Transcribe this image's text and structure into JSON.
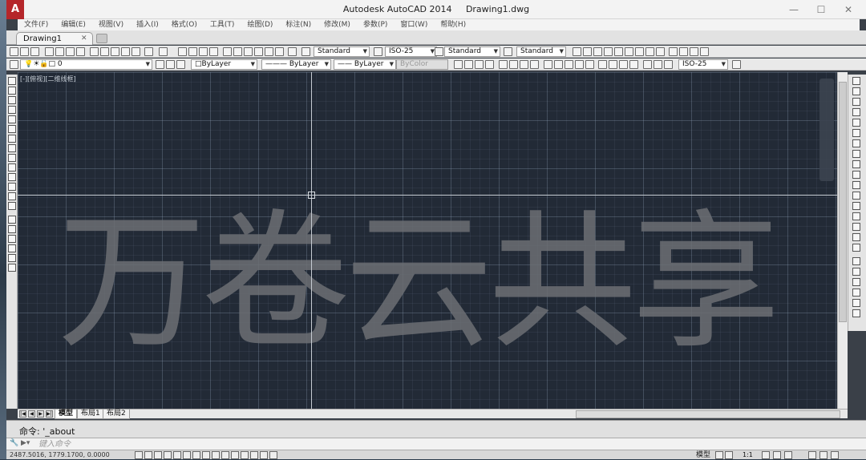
{
  "title": {
    "app": "Autodesk AutoCAD 2014",
    "file": "Drawing1.dwg",
    "logo": "A"
  },
  "window_buttons": {
    "minimize": "—",
    "maximize": "☐",
    "close": "✕"
  },
  "menu": [
    "文件(F)",
    "编辑(E)",
    "视图(V)",
    "插入(I)",
    "格式(O)",
    "工具(T)",
    "绘图(D)",
    "标注(N)",
    "修改(M)",
    "参数(P)",
    "窗口(W)",
    "帮助(H)"
  ],
  "doc_tab": {
    "label": "Drawing1",
    "close": "✕"
  },
  "toolbar1": {
    "text_style": "Standard",
    "dim_style": "ISO-25",
    "table_style": "Standard",
    "mleader_style": "Standard"
  },
  "toolbar2": {
    "layer": "0",
    "color": "ByLayer",
    "linetype": "ByLayer",
    "lineweight": "ByLayer",
    "plotstyle": "ByColor",
    "dim_style": "ISO-25"
  },
  "viewport_label": "[-][俯视][二维线框]",
  "watermark": "万卷云共享",
  "layout_tabs": [
    "模型",
    "布局1",
    "布局2"
  ],
  "command": {
    "history": "命令:  '_about",
    "placeholder": "键入命令"
  },
  "status": {
    "coords": "2487.5016, 1779.1700, 0.0000",
    "model": "模型",
    "scale": "1:1"
  }
}
